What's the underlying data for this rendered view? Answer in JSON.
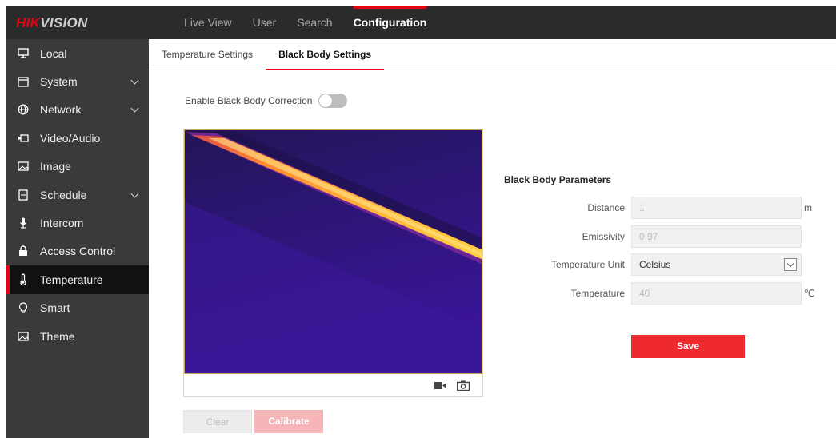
{
  "brand": {
    "logo_red": "HIK",
    "logo_grey": "VISION"
  },
  "topnav": [
    {
      "label": "Live View"
    },
    {
      "label": "User"
    },
    {
      "label": "Search"
    },
    {
      "label": "Configuration",
      "active": true
    }
  ],
  "sidebar": {
    "items": [
      {
        "label": "Local",
        "icon": "monitor-icon"
      },
      {
        "label": "System",
        "icon": "window-icon",
        "expandable": true
      },
      {
        "label": "Network",
        "icon": "globe-icon",
        "expandable": true
      },
      {
        "label": "Video/Audio",
        "icon": "camera-icon"
      },
      {
        "label": "Image",
        "icon": "image-icon"
      },
      {
        "label": "Schedule",
        "icon": "schedule-icon",
        "expandable": true
      },
      {
        "label": "Intercom",
        "icon": "microphone-icon"
      },
      {
        "label": "Access Control",
        "icon": "lock-icon"
      },
      {
        "label": "Temperature",
        "icon": "thermometer-icon",
        "active": true
      },
      {
        "label": "Smart",
        "icon": "bulb-icon"
      },
      {
        "label": "Theme",
        "icon": "theme-icon"
      }
    ]
  },
  "subtabs": [
    {
      "label": "Temperature Settings"
    },
    {
      "label": "Black Body Settings",
      "active": true
    }
  ],
  "enable_label": "Enable Black Body Correction",
  "enable_value": false,
  "buttons": {
    "clear": "Clear",
    "calibrate": "Calibrate",
    "save": "Save"
  },
  "params": {
    "title": "Black Body Parameters",
    "distance": {
      "label": "Distance",
      "value": "1",
      "unit": "m"
    },
    "emissivity": {
      "label": "Emissivity",
      "value": "0.97"
    },
    "temperature_unit": {
      "label": "Temperature Unit",
      "value": "Celsius"
    },
    "temperature": {
      "label": "Temperature",
      "value": "40",
      "unit": "℃"
    }
  },
  "colors": {
    "accent": "#e60012",
    "save_button": "#ee2a2f",
    "sidebar_bg": "#3a3a3a",
    "topbar_bg": "#2b2b2b"
  }
}
